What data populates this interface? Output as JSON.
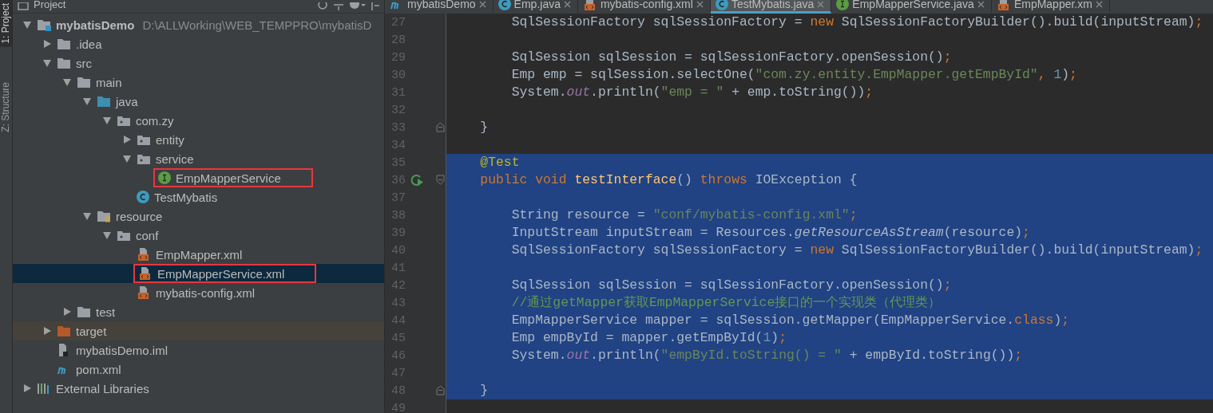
{
  "tool_strip": [
    {
      "label": "1: Project",
      "selected": true
    },
    {
      "label": "Z: Structure",
      "selected": false
    }
  ],
  "project_panel": {
    "title": "Project",
    "tree": [
      {
        "name": "mybatisDemo",
        "path": "D:\\ALLWorking\\WEB_TEMPPRO\\mybatisD",
        "kind": "module",
        "expanded": true,
        "selected": false,
        "annotated": false,
        "children": [
          {
            "name": ".idea",
            "kind": "folder",
            "expanded": false,
            "selected": false,
            "annotated": false
          },
          {
            "name": "src",
            "kind": "folder",
            "expanded": true,
            "selected": false,
            "annotated": false,
            "children": [
              {
                "name": "main",
                "kind": "folder",
                "expanded": true,
                "selected": false,
                "annotated": false,
                "children": [
                  {
                    "name": "java",
                    "kind": "source-folder",
                    "expanded": true,
                    "selected": false,
                    "annotated": false,
                    "children": [
                      {
                        "name": "com.zy",
                        "kind": "package",
                        "expanded": true,
                        "selected": false,
                        "annotated": false,
                        "children": [
                          {
                            "name": "entity",
                            "kind": "package",
                            "expanded": false,
                            "selected": false,
                            "annotated": false
                          },
                          {
                            "name": "service",
                            "kind": "package",
                            "expanded": true,
                            "selected": false,
                            "annotated": false,
                            "children": [
                              {
                                "name": "EmpMapperService",
                                "kind": "interface",
                                "selected": false,
                                "annotated": true
                              }
                            ]
                          },
                          {
                            "name": "TestMybatis",
                            "kind": "class",
                            "selected": false,
                            "annotated": false
                          }
                        ]
                      }
                    ]
                  },
                  {
                    "name": "resource",
                    "kind": "resource-folder",
                    "expanded": true,
                    "selected": false,
                    "annotated": false,
                    "children": [
                      {
                        "name": "conf",
                        "kind": "package",
                        "expanded": true,
                        "selected": false,
                        "annotated": false,
                        "children": [
                          {
                            "name": "EmpMapper.xml",
                            "kind": "xml",
                            "selected": false,
                            "annotated": false
                          },
                          {
                            "name": "EmpMapperService.xml",
                            "kind": "xml",
                            "selected": true,
                            "annotated": true
                          },
                          {
                            "name": "mybatis-config.xml",
                            "kind": "xml",
                            "selected": false,
                            "annotated": false
                          }
                        ]
                      }
                    ]
                  }
                ]
              },
              {
                "name": "test",
                "kind": "folder",
                "expanded": false,
                "selected": false,
                "annotated": false
              }
            ]
          },
          {
            "name": "target",
            "kind": "excluded-folder",
            "expanded": false,
            "selected": false,
            "annotated": false
          },
          {
            "name": "mybatisDemo.iml",
            "kind": "iml",
            "selected": false,
            "annotated": false
          },
          {
            "name": "pom.xml",
            "kind": "maven",
            "selected": false,
            "annotated": false
          }
        ]
      },
      {
        "name": "External Libraries",
        "kind": "libraries",
        "expanded": false,
        "selected": false,
        "annotated": false
      }
    ]
  },
  "editor": {
    "tabs": [
      {
        "label": "mybatisDemo",
        "kind": "maven",
        "selected": false
      },
      {
        "label": "Emp.java",
        "kind": "class",
        "selected": false
      },
      {
        "label": "mybatis-config.xml",
        "kind": "xml",
        "selected": false
      },
      {
        "label": "TestMybatis.java",
        "kind": "class",
        "selected": true
      },
      {
        "label": "EmpMapperService.java",
        "kind": "interface",
        "selected": false
      },
      {
        "label": "EmpMapper.xm",
        "kind": "xml",
        "selected": false
      }
    ],
    "lines": [
      {
        "number": "27",
        "selected": false,
        "tokens": [
          {
            "kind": "plain",
            "text": "        SqlSessionFactory sqlSessionFactory = "
          },
          {
            "kind": "keyword",
            "text": "new"
          },
          {
            "kind": "plain",
            "text": " SqlSessionFactoryBuilder().build(inputStream)"
          },
          {
            "kind": "keyword",
            "text": ";"
          }
        ]
      },
      {
        "number": "28",
        "selected": false
      },
      {
        "number": "29",
        "selected": false,
        "tokens": [
          {
            "kind": "plain",
            "text": "        SqlSession sqlSession = sqlSessionFactory.openSession()"
          },
          {
            "kind": "keyword",
            "text": ";"
          }
        ]
      },
      {
        "number": "30",
        "selected": false,
        "tokens": [
          {
            "kind": "plain",
            "text": "        Emp emp = sqlSession.selectOne("
          },
          {
            "kind": "string",
            "text": "\"com.zy.entity.EmpMapper.getEmpById\""
          },
          {
            "kind": "keyword",
            "text": ", "
          },
          {
            "kind": "number",
            "text": "1"
          },
          {
            "kind": "plain",
            "text": ")"
          },
          {
            "kind": "keyword",
            "text": ";"
          }
        ]
      },
      {
        "number": "31",
        "selected": false,
        "tokens": [
          {
            "kind": "plain",
            "text": "        System."
          },
          {
            "kind": "static",
            "text": "out"
          },
          {
            "kind": "plain",
            "text": ".println("
          },
          {
            "kind": "string",
            "text": "\"emp = \""
          },
          {
            "kind": "plain",
            "text": " + emp.toString())"
          },
          {
            "kind": "keyword",
            "text": ";"
          }
        ]
      },
      {
        "number": "32",
        "selected": false
      },
      {
        "number": "33",
        "selected": false,
        "gutter": [
          {
            "kind": "fold-end"
          }
        ],
        "tokens": [
          {
            "kind": "plain",
            "text": "    }"
          }
        ]
      },
      {
        "number": "34",
        "selected": false
      },
      {
        "number": "35",
        "selected": true,
        "tokens": [
          {
            "kind": "annotation",
            "text": "    @Test"
          }
        ]
      },
      {
        "number": "36",
        "selected": true,
        "gutter": [
          {
            "kind": "run"
          },
          {
            "kind": "fold-start"
          }
        ],
        "tokens": [
          {
            "kind": "keyword",
            "text": "    public void "
          },
          {
            "kind": "declaration",
            "text": "testInterface"
          },
          {
            "kind": "plain",
            "text": "() "
          },
          {
            "kind": "keyword",
            "text": "throws "
          },
          {
            "kind": "plain",
            "text": "IOException {"
          }
        ]
      },
      {
        "number": "37",
        "selected": true
      },
      {
        "number": "38",
        "selected": true,
        "tokens": [
          {
            "kind": "plain",
            "text": "        String resource = "
          },
          {
            "kind": "string",
            "text": "\"conf/mybatis-config.xml\""
          },
          {
            "kind": "keyword",
            "text": ";"
          }
        ]
      },
      {
        "number": "39",
        "selected": true,
        "tokens": [
          {
            "kind": "plain",
            "text": "        InputStream inputStream = Resources."
          },
          {
            "kind": "italic",
            "text": "getResourceAsStream"
          },
          {
            "kind": "plain",
            "text": "(resource)"
          },
          {
            "kind": "keyword",
            "text": ";"
          }
        ]
      },
      {
        "number": "40",
        "selected": true,
        "tokens": [
          {
            "kind": "plain",
            "text": "        SqlSessionFactory sqlSessionFactory = "
          },
          {
            "kind": "keyword",
            "text": "new"
          },
          {
            "kind": "plain",
            "text": " SqlSessionFactoryBuilder().build(inputStream)"
          },
          {
            "kind": "keyword",
            "text": ";"
          }
        ]
      },
      {
        "number": "41",
        "selected": true
      },
      {
        "number": "42",
        "selected": true,
        "tokens": [
          {
            "kind": "plain",
            "text": "        SqlSession sqlSession = sqlSessionFactory.openSession()"
          },
          {
            "kind": "keyword",
            "text": ";"
          }
        ]
      },
      {
        "number": "43",
        "selected": true,
        "tokens": [
          {
            "kind": "comment",
            "text": "        //通过getMapper获取EmpMapperService接口的一个实现类（代理类）"
          }
        ]
      },
      {
        "number": "44",
        "selected": true,
        "tokens": [
          {
            "kind": "plain",
            "text": "        EmpMapperService mapper = sqlSession.getMapper(EmpMapperService."
          },
          {
            "kind": "keyword",
            "text": "class"
          },
          {
            "kind": "plain",
            "text": ")"
          },
          {
            "kind": "keyword",
            "text": ";"
          }
        ]
      },
      {
        "number": "45",
        "selected": true,
        "tokens": [
          {
            "kind": "plain",
            "text": "        Emp empById = mapper.getEmpById("
          },
          {
            "kind": "number",
            "text": "1"
          },
          {
            "kind": "plain",
            "text": ")"
          },
          {
            "kind": "keyword",
            "text": ";"
          }
        ]
      },
      {
        "number": "46",
        "selected": true,
        "tokens": [
          {
            "kind": "plain",
            "text": "        System."
          },
          {
            "kind": "static",
            "text": "out"
          },
          {
            "kind": "plain",
            "text": ".println("
          },
          {
            "kind": "string",
            "text": "\"empById.toString() = \""
          },
          {
            "kind": "plain",
            "text": " + empById.toString())"
          },
          {
            "kind": "keyword",
            "text": ";"
          }
        ]
      },
      {
        "number": "47",
        "selected": true
      },
      {
        "number": "48",
        "selected": true,
        "gutter": [
          {
            "kind": "fold-end"
          }
        ],
        "tokens": [
          {
            "kind": "plain",
            "text": "    }"
          }
        ]
      },
      {
        "number": "49",
        "selected": false
      }
    ]
  }
}
